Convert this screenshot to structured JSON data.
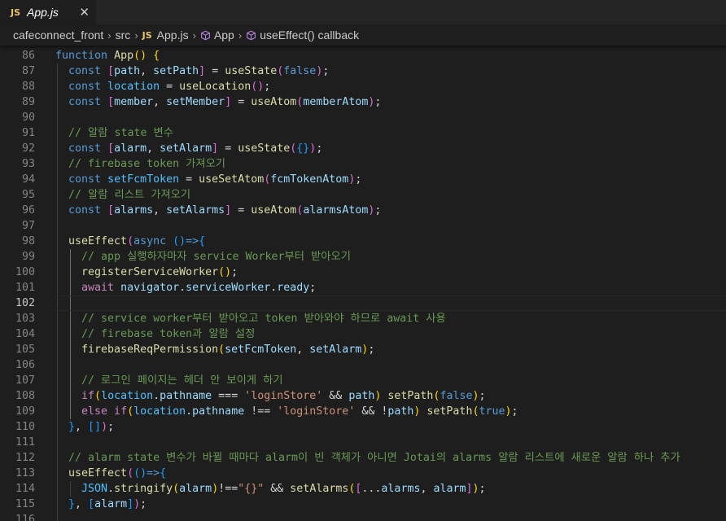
{
  "tab": {
    "icon": "JS",
    "name": "App.js",
    "close": "✕"
  },
  "breadcrumb": {
    "folder1": "cafeconnect_front",
    "folder2": "src",
    "file_icon": "JS",
    "file": "App.js",
    "symbol1": "App",
    "symbol2": "useEffect() callback"
  },
  "colors": {
    "background": "#1e1e1e",
    "tabbar": "#252526",
    "keyword": "#569cd6",
    "comment": "#6a9955"
  },
  "lines": [
    {
      "n": "86",
      "t": [
        [
          "kw",
          "function "
        ],
        [
          "fn",
          "App"
        ],
        [
          "b1",
          "() {"
        ]
      ]
    },
    {
      "n": "87",
      "t": [
        [
          "p",
          "  "
        ],
        [
          "kw",
          "const "
        ],
        [
          "b2",
          "["
        ],
        [
          "var",
          "path"
        ],
        [
          "p",
          ", "
        ],
        [
          "var",
          "setPath"
        ],
        [
          "b2",
          "]"
        ],
        [
          "p",
          " = "
        ],
        [
          "fn",
          "useState"
        ],
        [
          "b2",
          "("
        ],
        [
          "kw",
          "false"
        ],
        [
          "b2",
          ")"
        ],
        [
          "p",
          ";"
        ]
      ]
    },
    {
      "n": "88",
      "t": [
        [
          "p",
          "  "
        ],
        [
          "kw",
          "const "
        ],
        [
          "cst",
          "location"
        ],
        [
          "p",
          " = "
        ],
        [
          "fn",
          "useLocation"
        ],
        [
          "b2",
          "()"
        ],
        [
          "p",
          ";"
        ]
      ]
    },
    {
      "n": "89",
      "t": [
        [
          "p",
          "  "
        ],
        [
          "kw",
          "const "
        ],
        [
          "b2",
          "["
        ],
        [
          "var",
          "member"
        ],
        [
          "p",
          ", "
        ],
        [
          "var",
          "setMember"
        ],
        [
          "b2",
          "]"
        ],
        [
          "p",
          " = "
        ],
        [
          "fn",
          "useAtom"
        ],
        [
          "b2",
          "("
        ],
        [
          "var",
          "memberAtom"
        ],
        [
          "b2",
          ")"
        ],
        [
          "p",
          ";"
        ]
      ]
    },
    {
      "n": "90",
      "t": []
    },
    {
      "n": "91",
      "t": [
        [
          "p",
          "  "
        ],
        [
          "cm",
          "// 알람 state 변수"
        ]
      ]
    },
    {
      "n": "92",
      "t": [
        [
          "p",
          "  "
        ],
        [
          "kw",
          "const "
        ],
        [
          "b2",
          "["
        ],
        [
          "var",
          "alarm"
        ],
        [
          "p",
          ", "
        ],
        [
          "var",
          "setAlarm"
        ],
        [
          "b2",
          "]"
        ],
        [
          "p",
          " = "
        ],
        [
          "fn",
          "useState"
        ],
        [
          "b2",
          "("
        ],
        [
          "b3",
          "{}"
        ],
        [
          "b2",
          ")"
        ],
        [
          "p",
          ";"
        ]
      ]
    },
    {
      "n": "93",
      "t": [
        [
          "p",
          "  "
        ],
        [
          "cm",
          "// firebase token 가져오기"
        ]
      ]
    },
    {
      "n": "94",
      "t": [
        [
          "p",
          "  "
        ],
        [
          "kw",
          "const "
        ],
        [
          "cst",
          "setFcmToken"
        ],
        [
          "p",
          " = "
        ],
        [
          "fn",
          "useSetAtom"
        ],
        [
          "b2",
          "("
        ],
        [
          "var",
          "fcmTokenAtom"
        ],
        [
          "b2",
          ")"
        ],
        [
          "p",
          ";"
        ]
      ]
    },
    {
      "n": "95",
      "t": [
        [
          "p",
          "  "
        ],
        [
          "cm",
          "// 알람 리스트 가져오기"
        ]
      ]
    },
    {
      "n": "96",
      "t": [
        [
          "p",
          "  "
        ],
        [
          "kw",
          "const "
        ],
        [
          "b2",
          "["
        ],
        [
          "var",
          "alarms"
        ],
        [
          "p",
          ", "
        ],
        [
          "var",
          "setAlarms"
        ],
        [
          "b2",
          "]"
        ],
        [
          "p",
          " = "
        ],
        [
          "fn",
          "useAtom"
        ],
        [
          "b2",
          "("
        ],
        [
          "var",
          "alarmsAtom"
        ],
        [
          "b2",
          ")"
        ],
        [
          "p",
          ";"
        ]
      ]
    },
    {
      "n": "97",
      "t": []
    },
    {
      "n": "98",
      "t": [
        [
          "p",
          "  "
        ],
        [
          "fn",
          "useEffect"
        ],
        [
          "b2",
          "("
        ],
        [
          "kw",
          "async "
        ],
        [
          "b3",
          "()"
        ],
        [
          "kw",
          "=>"
        ],
        [
          "b3",
          "{"
        ]
      ]
    },
    {
      "n": "99",
      "t": [
        [
          "p",
          "    "
        ],
        [
          "cm",
          "// app 실행하자마자 service Worker부터 받아오기"
        ]
      ]
    },
    {
      "n": "100",
      "t": [
        [
          "p",
          "    "
        ],
        [
          "fn",
          "registerServiceWorker"
        ],
        [
          "b1",
          "()"
        ],
        [
          "p",
          ";"
        ]
      ]
    },
    {
      "n": "101",
      "t": [
        [
          "p",
          "    "
        ],
        [
          "ctl",
          "await "
        ],
        [
          "var",
          "navigator"
        ],
        [
          "p",
          "."
        ],
        [
          "var",
          "serviceWorker"
        ],
        [
          "p",
          "."
        ],
        [
          "var",
          "ready"
        ],
        [
          "p",
          ";"
        ]
      ]
    },
    {
      "n": "102",
      "t": []
    },
    {
      "n": "103",
      "t": [
        [
          "p",
          "    "
        ],
        [
          "cm",
          "// service worker부터 받아오고 token 받아와야 하므로 await 사용"
        ]
      ]
    },
    {
      "n": "104",
      "t": [
        [
          "p",
          "    "
        ],
        [
          "cm",
          "// firebase token과 알람 설정"
        ]
      ]
    },
    {
      "n": "105",
      "t": [
        [
          "p",
          "    "
        ],
        [
          "fn",
          "firebaseReqPermission"
        ],
        [
          "b1",
          "("
        ],
        [
          "var",
          "setFcmToken"
        ],
        [
          "p",
          ", "
        ],
        [
          "var",
          "setAlarm"
        ],
        [
          "b1",
          ")"
        ],
        [
          "p",
          ";"
        ]
      ]
    },
    {
      "n": "106",
      "t": []
    },
    {
      "n": "107",
      "t": [
        [
          "p",
          "    "
        ],
        [
          "cm",
          "// 로그인 페이지는 헤더 안 보이게 하기"
        ]
      ]
    },
    {
      "n": "108",
      "t": [
        [
          "p",
          "    "
        ],
        [
          "ctl",
          "if"
        ],
        [
          "b1",
          "("
        ],
        [
          "cst",
          "location"
        ],
        [
          "p",
          "."
        ],
        [
          "var",
          "pathname"
        ],
        [
          "p",
          " === "
        ],
        [
          "str",
          "'loginStore'"
        ],
        [
          "p",
          " && "
        ],
        [
          "var",
          "path"
        ],
        [
          "b1",
          ")"
        ],
        [
          "p",
          " "
        ],
        [
          "fn",
          "setPath"
        ],
        [
          "b1",
          "("
        ],
        [
          "kw",
          "false"
        ],
        [
          "b1",
          ")"
        ],
        [
          "p",
          ";"
        ]
      ]
    },
    {
      "n": "109",
      "t": [
        [
          "p",
          "    "
        ],
        [
          "ctl",
          "else if"
        ],
        [
          "b1",
          "("
        ],
        [
          "cst",
          "location"
        ],
        [
          "p",
          "."
        ],
        [
          "var",
          "pathname"
        ],
        [
          "p",
          " !== "
        ],
        [
          "str",
          "'loginStore'"
        ],
        [
          "p",
          " && !"
        ],
        [
          "var",
          "path"
        ],
        [
          "b1",
          ")"
        ],
        [
          "p",
          " "
        ],
        [
          "fn",
          "setPath"
        ],
        [
          "b1",
          "("
        ],
        [
          "kw",
          "true"
        ],
        [
          "b1",
          ")"
        ],
        [
          "p",
          ";"
        ]
      ]
    },
    {
      "n": "110",
      "t": [
        [
          "p",
          "  "
        ],
        [
          "b3",
          "}"
        ],
        [
          "p",
          ", "
        ],
        [
          "b3",
          "[]"
        ],
        [
          "b2",
          ")"
        ],
        [
          "p",
          ";"
        ]
      ]
    },
    {
      "n": "111",
      "t": []
    },
    {
      "n": "112",
      "t": [
        [
          "p",
          "  "
        ],
        [
          "cm",
          "// alarm state 변수가 바뀔 때마다 alarm이 빈 객체가 아니면 Jotai의 alarms 알람 리스트에 새로운 알람 하나 추가"
        ]
      ]
    },
    {
      "n": "113",
      "t": [
        [
          "p",
          "  "
        ],
        [
          "fn",
          "useEffect"
        ],
        [
          "b2",
          "("
        ],
        [
          "b3",
          "()"
        ],
        [
          "kw",
          "=>"
        ],
        [
          "b3",
          "{"
        ]
      ]
    },
    {
      "n": "114",
      "t": [
        [
          "p",
          "    "
        ],
        [
          "cst",
          "JSON"
        ],
        [
          "p",
          "."
        ],
        [
          "fn",
          "stringify"
        ],
        [
          "b1",
          "("
        ],
        [
          "var",
          "alarm"
        ],
        [
          "b1",
          ")"
        ],
        [
          "p",
          "!=="
        ],
        [
          "str",
          "\"{}\""
        ],
        [
          "p",
          " && "
        ],
        [
          "fn",
          "setAlarms"
        ],
        [
          "b1",
          "("
        ],
        [
          "b2",
          "["
        ],
        [
          "p",
          "..."
        ],
        [
          "var",
          "alarms"
        ],
        [
          "p",
          ", "
        ],
        [
          "var",
          "alarm"
        ],
        [
          "b2",
          "]"
        ],
        [
          "b1",
          ")"
        ],
        [
          "p",
          ";"
        ]
      ]
    },
    {
      "n": "115",
      "t": [
        [
          "p",
          "  "
        ],
        [
          "b3",
          "}"
        ],
        [
          "p",
          ", "
        ],
        [
          "b3",
          "["
        ],
        [
          "var",
          "alarm"
        ],
        [
          "b3",
          "]"
        ],
        [
          "b2",
          ")"
        ],
        [
          "p",
          ";"
        ]
      ]
    },
    {
      "n": "116",
      "t": []
    }
  ]
}
